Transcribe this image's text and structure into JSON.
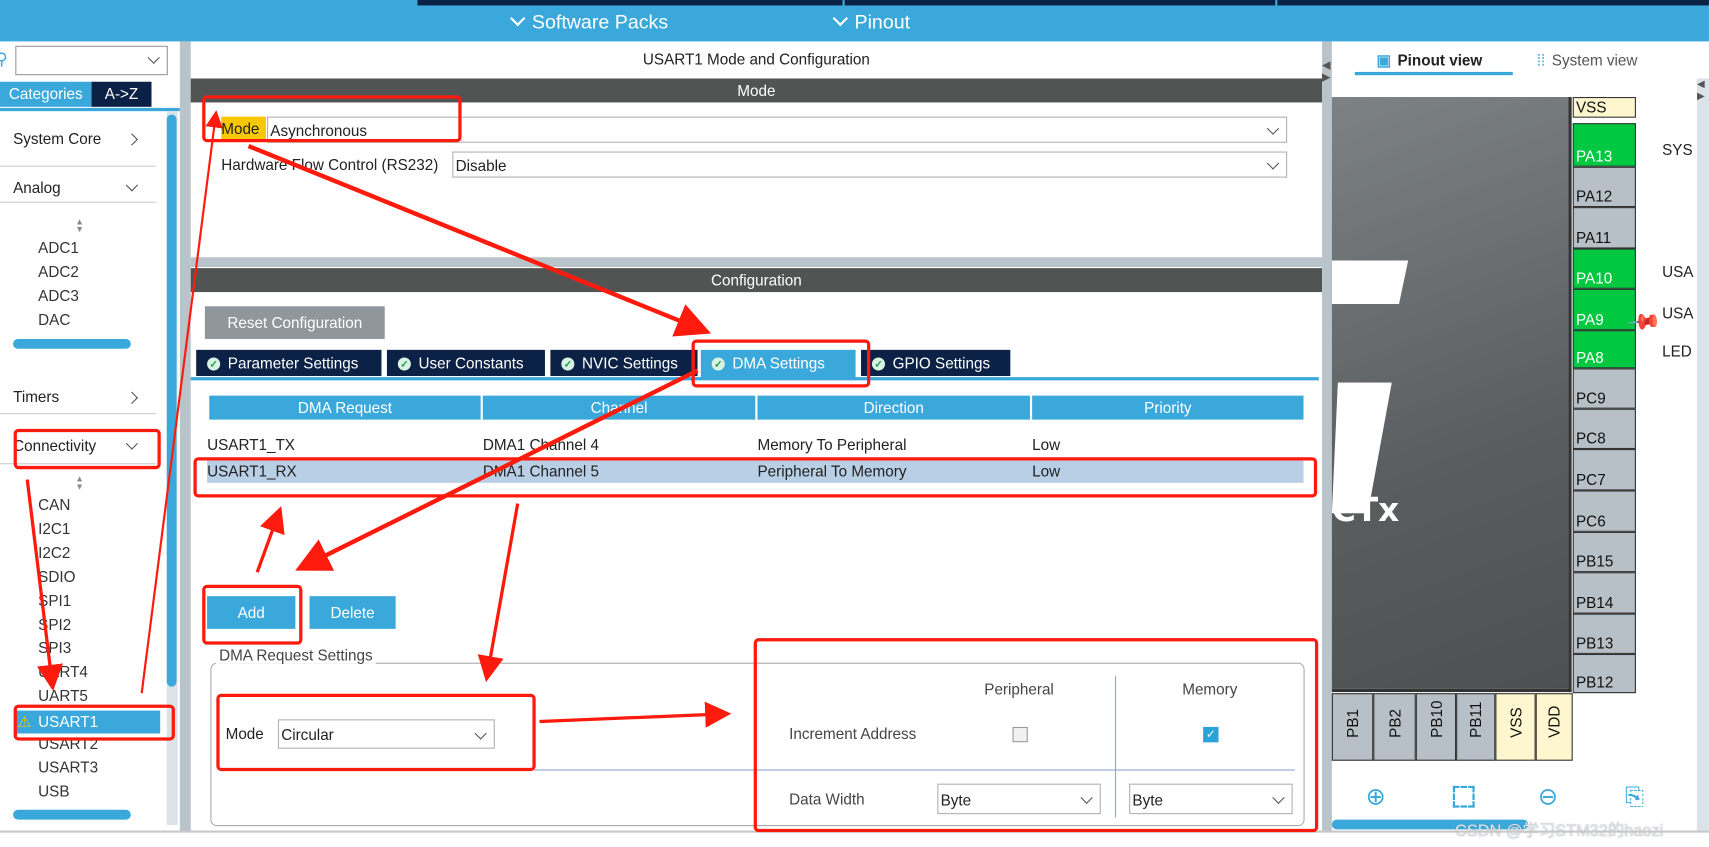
{
  "topbar": {
    "tabs": [
      {
        "label": "Software Packs"
      },
      {
        "label": "Pinout"
      }
    ]
  },
  "sidebar": {
    "search_value": "",
    "tabs": [
      {
        "label": "Categories",
        "active": true
      },
      {
        "label": "A->Z",
        "active": false
      }
    ],
    "categories": [
      {
        "label": "System Core",
        "expanded": false
      },
      {
        "label": "Analog",
        "expanded": true,
        "items": [
          "ADC1",
          "ADC2",
          "ADC3",
          "DAC"
        ]
      },
      {
        "label": "Timers",
        "expanded": false
      },
      {
        "label": "Connectivity",
        "expanded": true,
        "items": [
          "CAN",
          "I2C1",
          "I2C2",
          "SDIO",
          "SPI1",
          "SPI2",
          "SPI3",
          "UART4",
          "UART5",
          "USART1",
          "USART2",
          "USART3",
          "USB"
        ],
        "selected": "USART1"
      }
    ]
  },
  "main": {
    "title": "USART1 Mode and Configuration",
    "mode_header": "Mode",
    "mode_label": "Mode",
    "mode_value": "Asynchronous",
    "hwflow_label": "Hardware Flow Control (RS232)",
    "hwflow_value": "Disable",
    "config_header": "Configuration",
    "reset_label": "Reset Configuration",
    "tabs": [
      {
        "label": "Parameter Settings"
      },
      {
        "label": "User Constants"
      },
      {
        "label": "NVIC Settings"
      },
      {
        "label": "DMA Settings",
        "active": true
      },
      {
        "label": "GPIO Settings"
      }
    ],
    "table": {
      "columns": [
        "DMA Request",
        "Channel",
        "Direction",
        "Priority"
      ],
      "rows": [
        {
          "request": "USART1_TX",
          "channel": "DMA1 Channel 4",
          "direction": "Memory To Peripheral",
          "priority": "Low"
        },
        {
          "request": "USART1_RX",
          "channel": "DMA1 Channel 5",
          "direction": "Peripheral To Memory",
          "priority": "Low",
          "selected": true
        }
      ]
    },
    "add_label": "Add",
    "delete_label": "Delete",
    "settings": {
      "title": "DMA Request Settings",
      "mode_label": "Mode",
      "mode_value": "Circular",
      "peripheral_header": "Peripheral",
      "memory_header": "Memory",
      "increment_label": "Increment Address",
      "increment_peripheral": false,
      "increment_memory": true,
      "width_label": "Data Width",
      "width_peripheral": "Byte",
      "width_memory": "Byte"
    }
  },
  "right": {
    "tabs": [
      {
        "label": "Pinout view",
        "active": true
      },
      {
        "label": "System view"
      }
    ],
    "chip_text": "CTx",
    "pins_right": [
      {
        "name": "VSS",
        "type": "yellow"
      },
      {
        "name": "PA13",
        "type": "green",
        "label": "SYS"
      },
      {
        "name": "PA12",
        "type": "gray"
      },
      {
        "name": "PA11",
        "type": "gray"
      },
      {
        "name": "PA10",
        "type": "green",
        "label": "USA"
      },
      {
        "name": "PA9",
        "type": "green",
        "label": "USA"
      },
      {
        "name": "PA8",
        "type": "green",
        "label": "LED"
      },
      {
        "name": "PC9",
        "type": "gray"
      },
      {
        "name": "PC8",
        "type": "gray"
      },
      {
        "name": "PC7",
        "type": "gray"
      },
      {
        "name": "PC6",
        "type": "gray"
      },
      {
        "name": "PB15",
        "type": "gray"
      },
      {
        "name": "PB14",
        "type": "gray"
      },
      {
        "name": "PB13",
        "type": "gray"
      },
      {
        "name": "PB12",
        "type": "gray"
      }
    ],
    "pins_bottom": [
      {
        "name": "PB1",
        "type": "gray"
      },
      {
        "name": "PB2",
        "type": "gray"
      },
      {
        "name": "PB10",
        "type": "gray"
      },
      {
        "name": "PB11",
        "type": "gray"
      },
      {
        "name": "VSS",
        "type": "yellow"
      },
      {
        "name": "VDD",
        "type": "yellow"
      }
    ],
    "toolbar_icons": [
      "zoom-in-icon",
      "fit-screen-icon",
      "zoom-out-icon",
      "export-icon"
    ]
  },
  "watermark": "CSDN @学习STM32的haozi",
  "colors": {
    "accent": "#3aa8db",
    "navy": "#0b2246",
    "header": "#525454",
    "pin_green": "#00c840",
    "annotation": "#ff1a0e",
    "row_selected": "#b8cfe6"
  }
}
